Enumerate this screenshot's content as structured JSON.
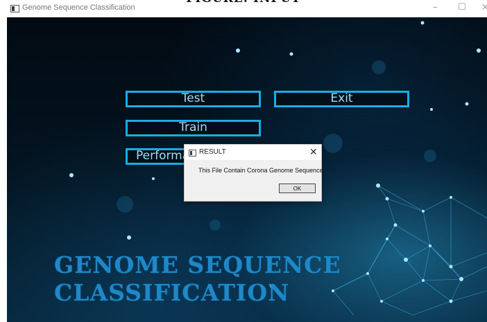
{
  "caption": "FIGURE: INPUT",
  "window": {
    "title": "Genome Sequence Classification",
    "icon": "app-window-icon",
    "controls": {
      "minimize": "–",
      "maximize": "☐",
      "close": "×"
    }
  },
  "buttons": {
    "test": "Test",
    "exit": "Exit",
    "train": "Train",
    "performance": "Performa"
  },
  "banner": {
    "line1": "GENOME SEQUENCE",
    "line2": "CLASSIFICATION"
  },
  "dialog": {
    "title": "RESULT",
    "close": "✕",
    "message": "This File Contain Corona Genome Sequence",
    "ok": "OK"
  },
  "colors": {
    "accent": "#18aee8",
    "banner_text": "#1e88c8",
    "background": "#031522"
  }
}
